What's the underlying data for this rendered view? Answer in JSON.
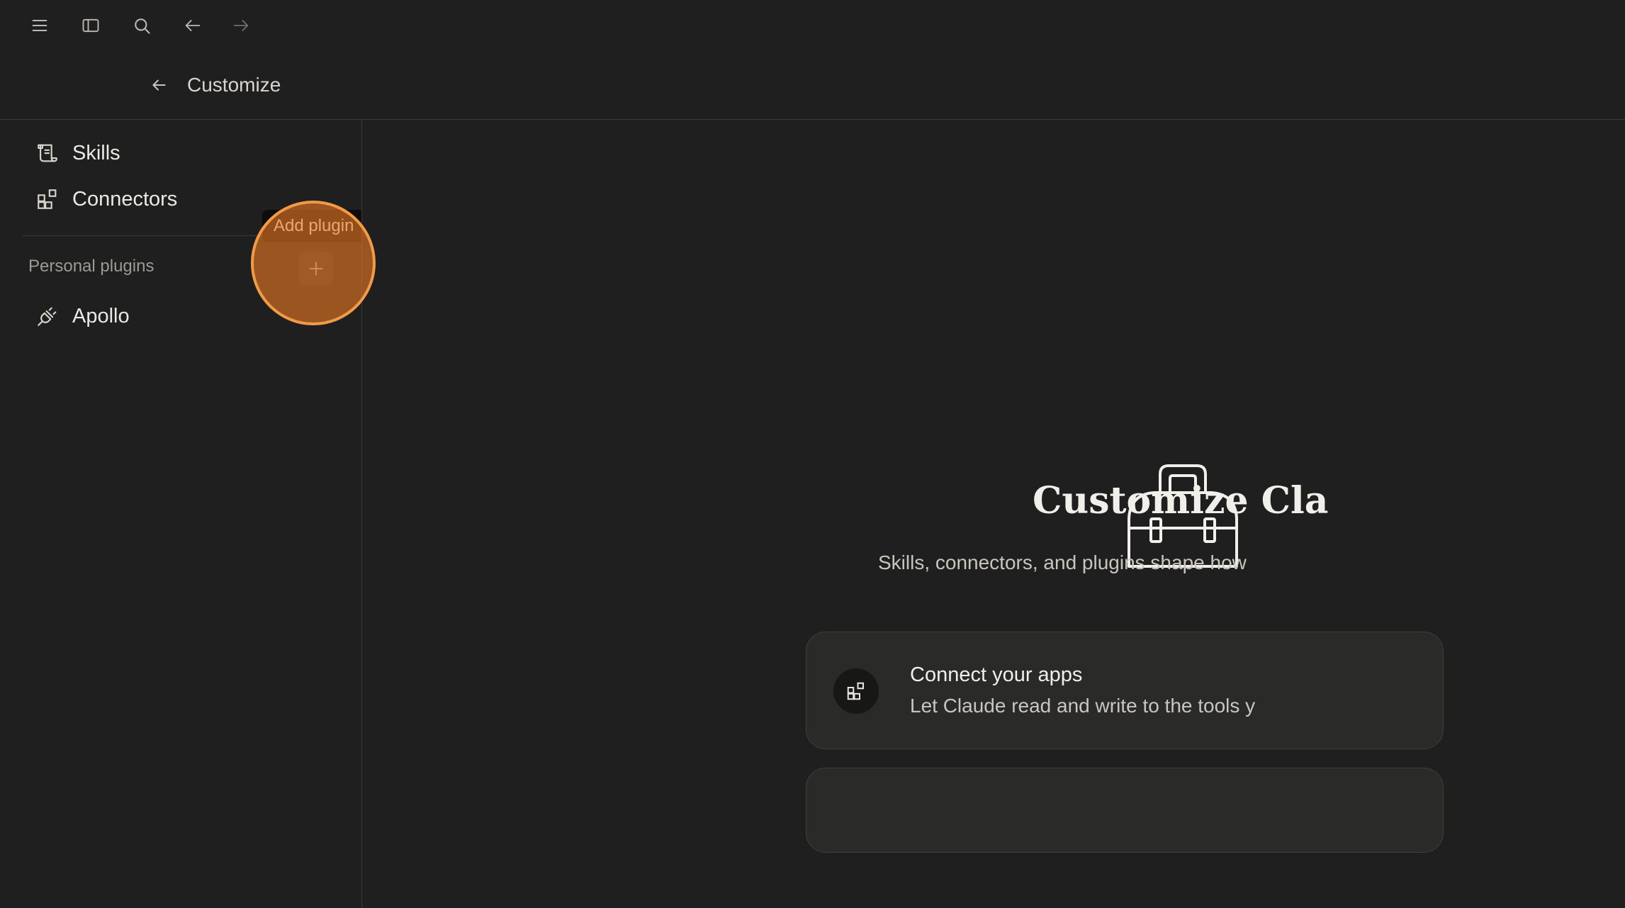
{
  "topbar": {
    "menu_icon": "hamburger-menu-icon",
    "sidebar_icon": "sidebar-toggle-icon",
    "search_icon": "search-icon",
    "back_icon": "arrow-left-icon",
    "forward_icon": "arrow-right-icon"
  },
  "header": {
    "back_icon": "arrow-left-icon",
    "title": "Customize"
  },
  "sidebar": {
    "items": [
      {
        "label": "Skills",
        "icon": "skills-scroll-icon"
      },
      {
        "label": "Connectors",
        "icon": "connectors-grid-icon"
      }
    ],
    "section_label": "Personal plugins",
    "add_plugin_tooltip": "Add plugin",
    "plugins": [
      {
        "label": "Apollo",
        "icon": "plug-icon"
      }
    ]
  },
  "main": {
    "hero_icon": "toolbox-icon",
    "title": "Customize Cla",
    "subtitle": "Skills, connectors, and plugins shape how",
    "cards": [
      {
        "title": "Connect your apps",
        "description": "Let Claude read and write to the tools y",
        "icon": "connectors-grid-icon"
      }
    ]
  },
  "colors": {
    "background": "#1f1f1f",
    "accent_click": "#f39a47"
  }
}
